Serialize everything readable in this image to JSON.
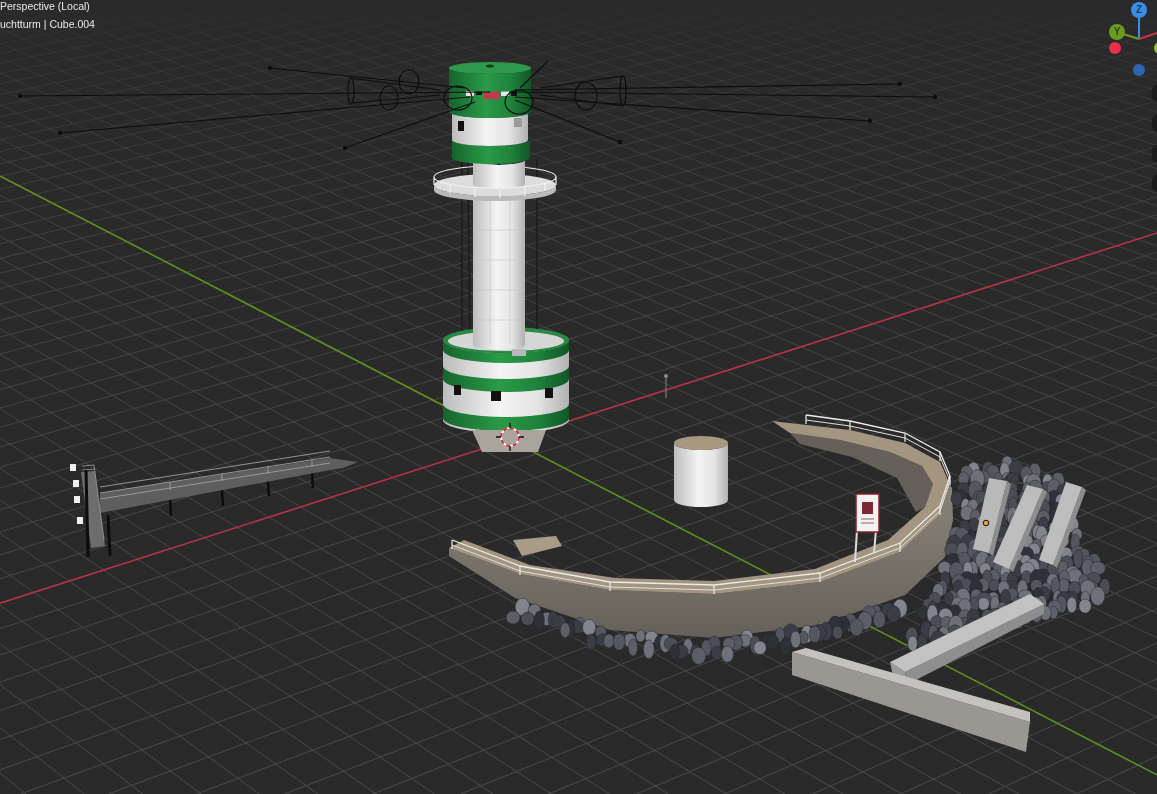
{
  "viewport": {
    "view_name": "Perspective (Local)",
    "object_path": "uchtturm | Cube.004"
  },
  "navigation_gizmo": {
    "axes": [
      {
        "label": "Z",
        "color": "#3a8ee6"
      },
      {
        "label": "Y",
        "color": "#6c9c1f"
      }
    ]
  }
}
